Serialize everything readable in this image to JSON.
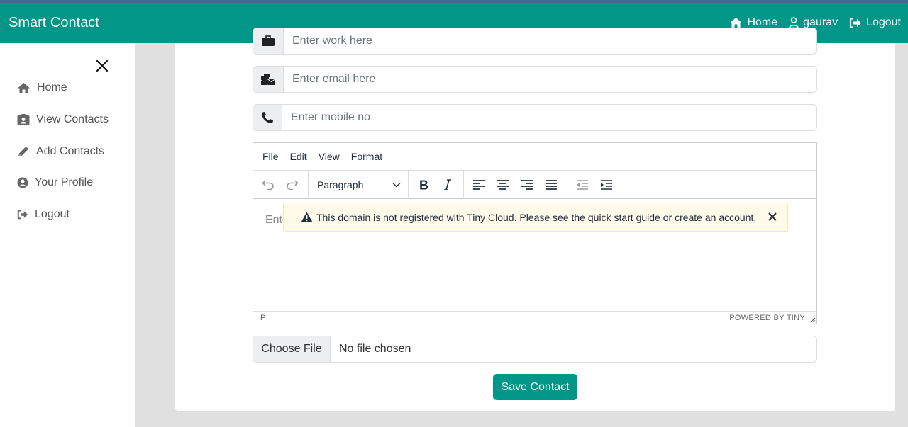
{
  "navbar": {
    "brand": "Smart Contact",
    "links": [
      {
        "label": "Home",
        "icon": "home-icon"
      },
      {
        "label": "gaurav",
        "icon": "user-icon"
      },
      {
        "label": "Logout",
        "icon": "sign-out-icon"
      }
    ]
  },
  "sidebar": {
    "items": [
      {
        "label": "Home",
        "icon": "home-icon"
      },
      {
        "label": "View Contacts",
        "icon": "id-badge-icon"
      },
      {
        "label": "Add Contacts",
        "icon": "pencil-icon"
      },
      {
        "label": "Your Profile",
        "icon": "user-circle-icon"
      },
      {
        "label": "Logout",
        "icon": "sign-out-icon"
      }
    ]
  },
  "form": {
    "work_placeholder": "Enter work here",
    "email_placeholder": "Enter email here",
    "mobile_placeholder": "Enter mobile no."
  },
  "editor": {
    "menu": [
      "File",
      "Edit",
      "View",
      "Format"
    ],
    "block_format": "Paragraph",
    "placeholder": "Enter",
    "status_path": "P",
    "powered_by": "POWERED BY TINY"
  },
  "notice": {
    "text_before": "This domain is not registered with Tiny Cloud. Please see the ",
    "link1": "quick start guide",
    "text_middle": " or ",
    "link2": "create an account",
    "text_after": "."
  },
  "file": {
    "button_label": "Choose File",
    "status": "No file chosen"
  },
  "save_label": "Save Contact",
  "colors": {
    "primary": "#009688",
    "notice_bg": "#fffaea",
    "background": "#e0e0e0"
  }
}
